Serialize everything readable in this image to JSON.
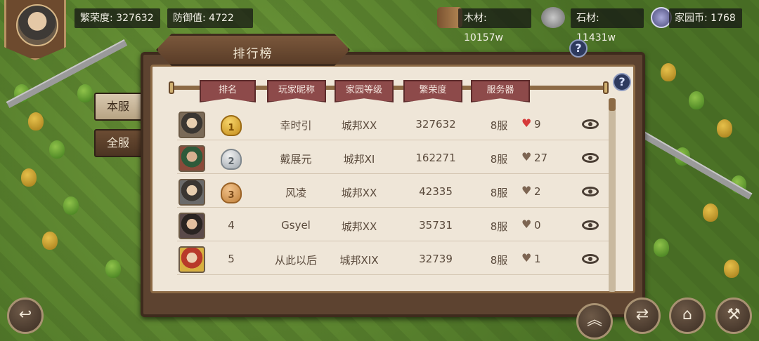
{
  "hud": {
    "prosperity_label": "繁荣度: 327632",
    "defense_label": "防御值: 4722",
    "wood_label": "木材: 10157w",
    "stone_label": "石材: 11431w",
    "home_coin_label": "家园币: 1768"
  },
  "panel": {
    "title": "排行榜",
    "help_glyph": "?"
  },
  "tabs": [
    {
      "label": "本服",
      "active": true
    },
    {
      "label": "全服",
      "active": false
    }
  ],
  "columns": [
    "排名",
    "玩家昵称",
    "家园等级",
    "繁荣度",
    "服务器"
  ],
  "rows": [
    {
      "rank": "1",
      "name": "幸时引",
      "level": "城邦XX",
      "prosperity": "327632",
      "server": "8服",
      "likes": "9",
      "liked": true,
      "medal": "gold"
    },
    {
      "rank": "2",
      "name": "戴展元",
      "level": "城邦XI",
      "prosperity": "162271",
      "server": "8服",
      "likes": "27",
      "liked": false,
      "medal": "silver"
    },
    {
      "rank": "3",
      "name": "风凌",
      "level": "城邦XX",
      "prosperity": "42335",
      "server": "8服",
      "likes": "2",
      "liked": false,
      "medal": "bronze"
    },
    {
      "rank": "4",
      "name": "Gsyel",
      "level": "城邦XX",
      "prosperity": "35731",
      "server": "8服",
      "likes": "0",
      "liked": false,
      "medal": ""
    },
    {
      "rank": "5",
      "name": "从此以后",
      "level": "城邦XIX",
      "prosperity": "32739",
      "server": "8服",
      "likes": "1",
      "liked": false,
      "medal": ""
    }
  ],
  "icons": {
    "heart": "♥",
    "back_arrow": "↩",
    "swap": "⇄",
    "hammer": "⚒",
    "chevron_up": "︽",
    "build": "⌂"
  },
  "colors": {
    "panel_brown": "#5d4330",
    "parchment": "#efe6d8",
    "header_red": "#8d4a4a",
    "heart_red": "#d63a3a"
  }
}
